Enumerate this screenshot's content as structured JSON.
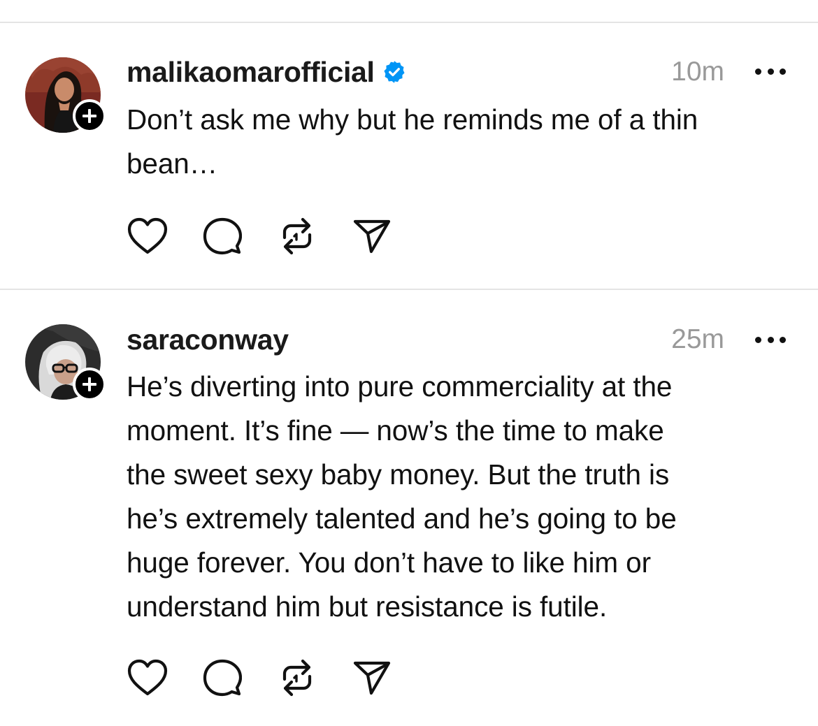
{
  "posts": [
    {
      "username": "malikaomarofficial",
      "verified": true,
      "timestamp": "10m",
      "text": "Don’t ask me why but he reminds me of a thin\nbean…",
      "avatar_icon": "avatar-woman-dark-hair",
      "badge_icon": "plus-icon",
      "more_icon": "ellipsis-icon",
      "actions": [
        "heart-icon",
        "comment-icon",
        "repost-icon",
        "share-icon"
      ]
    },
    {
      "username": "saraconway",
      "verified": false,
      "timestamp": "25m",
      "text": "He’s diverting into pure commerciality at the\nmoment. It’s fine — now’s the time to make\nthe sweet sexy baby money. But the truth is\nhe’s extremely talented and he’s going to be\nhuge forever.  You don’t have to like him or\nunderstand him but resistance is futile.",
      "avatar_icon": "avatar-woman-glasses",
      "badge_icon": "plus-icon",
      "more_icon": "ellipsis-icon",
      "actions": [
        "heart-icon",
        "comment-icon",
        "repost-icon",
        "share-icon"
      ]
    }
  ],
  "colors": {
    "verified_badge": "#0095f6",
    "timestamp": "#999999",
    "divider": "#e4e4e4",
    "text": "#111111"
  }
}
